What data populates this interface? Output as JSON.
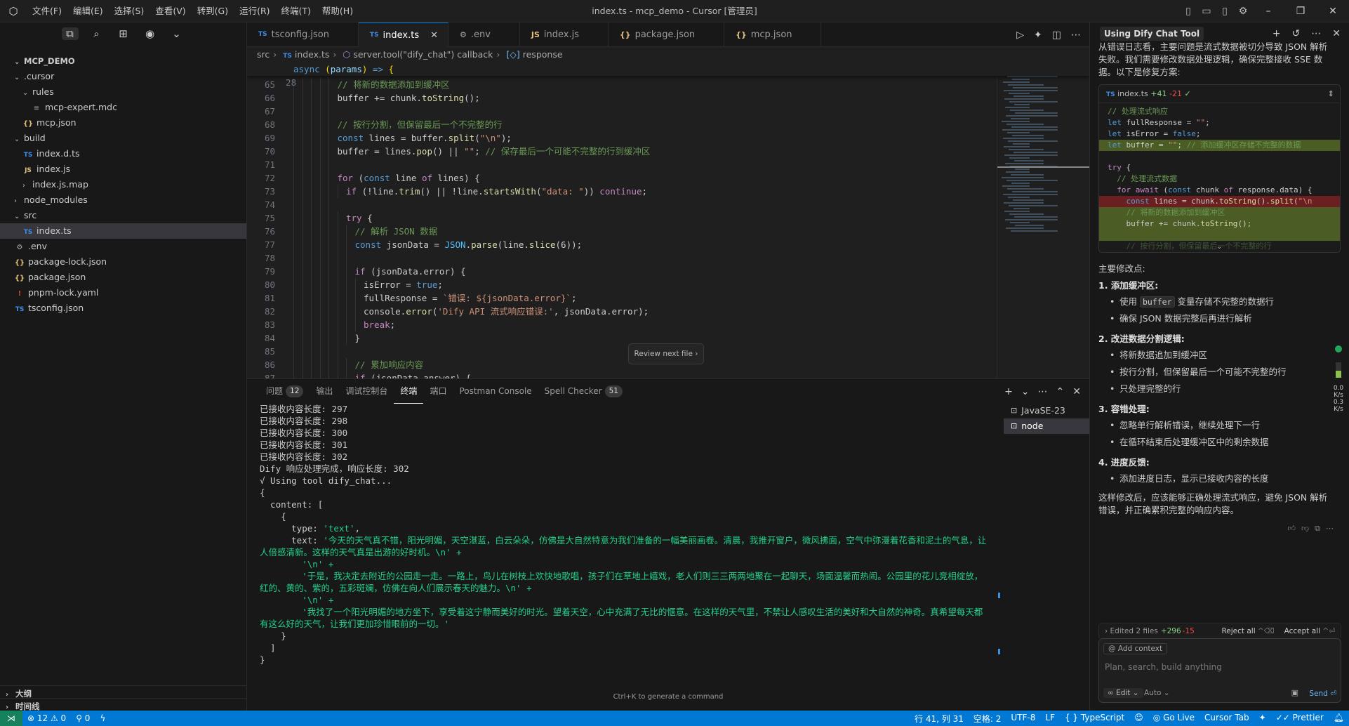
{
  "titlebar": {
    "menu": [
      "文件(F)",
      "编辑(E)",
      "选择(S)",
      "查看(V)",
      "转到(G)",
      "运行(R)",
      "终端(T)",
      "帮助(H)"
    ],
    "title": "index.ts - mcp_demo - Cursor [管理员]"
  },
  "explorer": {
    "root": "MCP_DEMO",
    "items": [
      {
        "label": ".cursor",
        "kind": "folder-open",
        "depth": 1
      },
      {
        "label": "rules",
        "kind": "folder-open",
        "depth": 2
      },
      {
        "label": "mcp-expert.mdc",
        "kind": "md",
        "depth": 3
      },
      {
        "label": "mcp.json",
        "kind": "json",
        "depth": 2
      },
      {
        "label": "build",
        "kind": "folder-open",
        "depth": 1
      },
      {
        "label": "index.d.ts",
        "kind": "ts",
        "depth": 2
      },
      {
        "label": "index.js",
        "kind": "js",
        "depth": 2
      },
      {
        "label": "index.js.map",
        "kind": "folder",
        "depth": 2
      },
      {
        "label": "node_modules",
        "kind": "folder",
        "depth": 1
      },
      {
        "label": "src",
        "kind": "folder-open",
        "depth": 1
      },
      {
        "label": "index.ts",
        "kind": "ts",
        "depth": 2,
        "selected": true
      },
      {
        "label": ".env",
        "kind": "gear",
        "depth": 1
      },
      {
        "label": "package-lock.json",
        "kind": "json",
        "depth": 1
      },
      {
        "label": "package.json",
        "kind": "json",
        "depth": 1
      },
      {
        "label": "pnpm-lock.yaml",
        "kind": "yaml",
        "depth": 1
      },
      {
        "label": "tsconfig.json",
        "kind": "ts",
        "depth": 1
      }
    ],
    "outline": "大纲",
    "timeline": "时间线"
  },
  "tabs": [
    {
      "label": "tsconfig.json",
      "icon": "TS",
      "active": false
    },
    {
      "label": "index.ts",
      "icon": "TS",
      "active": true
    },
    {
      "label": ".env",
      "icon": "gear",
      "active": false
    },
    {
      "label": "index.js",
      "icon": "JS",
      "active": false
    },
    {
      "label": "package.json",
      "icon": "{}",
      "active": false
    },
    {
      "label": "mcp.json",
      "icon": "{}",
      "active": false
    }
  ],
  "breadcrumb": [
    "src",
    "index.ts",
    "server.tool(\"dify_chat\") callback",
    "response"
  ],
  "editor": {
    "sticky": {
      "line": "28",
      "text": "async (params) => {"
    },
    "lines": [
      {
        "n": "65",
        "t": "// 将新的数据添加到缓冲区"
      },
      {
        "n": "66",
        "t": "buffer += chunk.toString();"
      },
      {
        "n": "67",
        "t": ""
      },
      {
        "n": "68",
        "t": "// 按行分割，但保留最后一个不完整的行"
      },
      {
        "n": "69",
        "t": "const lines = buffer.split(\"\\n\");"
      },
      {
        "n": "70",
        "t": "buffer = lines.pop() || \"\"; // 保存最后一个可能不完整的行到缓冲区"
      },
      {
        "n": "71",
        "t": ""
      },
      {
        "n": "72",
        "t": "for (const line of lines) {"
      },
      {
        "n": "73",
        "t": "if (!line.trim() || !line.startsWith(\"data: \")) continue;"
      },
      {
        "n": "74",
        "t": ""
      },
      {
        "n": "75",
        "t": "try {"
      },
      {
        "n": "76",
        "t": "// 解析 JSON 数据"
      },
      {
        "n": "77",
        "t": "const jsonData = JSON.parse(line.slice(6));"
      },
      {
        "n": "78",
        "t": ""
      },
      {
        "n": "79",
        "t": "if (jsonData.error) {"
      },
      {
        "n": "80",
        "t": "isError = true;"
      },
      {
        "n": "81",
        "t": "fullResponse = `错误: ${jsonData.error}`;"
      },
      {
        "n": "82",
        "t": "console.error('Dify API 流式响应错误:', jsonData.error);"
      },
      {
        "n": "83",
        "t": "break;"
      },
      {
        "n": "84",
        "t": "}"
      },
      {
        "n": "85",
        "t": ""
      },
      {
        "n": "86",
        "t": "// 累加响应内容"
      },
      {
        "n": "87",
        "t": "if (jsonData.answer) {"
      }
    ],
    "review_button": "Review next file"
  },
  "panel": {
    "tabs": [
      {
        "label": "问题",
        "badge": "12"
      },
      {
        "label": "输出"
      },
      {
        "label": "调试控制台"
      },
      {
        "label": "终端",
        "active": true
      },
      {
        "label": "端口"
      },
      {
        "label": "Postman Console"
      },
      {
        "label": "Spell Checker",
        "badge": "51"
      }
    ],
    "terminal_lines": [
      "已接收内容长度: 297",
      "已接收内容长度: 298",
      "已接收内容长度: 300",
      "已接收内容长度: 301",
      "已接收内容长度: 302",
      "Dify 响应处理完成，响应长度: 302",
      "√ Using tool dify_chat...",
      "{",
      "  content: [",
      "    {",
      "      type: 'text',"
    ],
    "terminal_text_label": "      text: ",
    "terminal_wrapped": [
      "'今天的天气真不错，阳光明媚，天空湛蓝，白云朵朵，仿佛是大自然特意为我们准备的一幅美丽画卷。清晨，我推开窗户，微风拂面，空气中弥漫着花香和泥土的气息，让人倍感清新。这样的天气真是出游的好时机。\\n' +",
      "'\\n' +",
      "'于是，我决定去附近的公园走一走。一路上，鸟儿在树枝上欢快地歌唱，孩子们在草地上嬉戏，老人们则三三两两地聚在一起聊天，场面温馨而热闹。公园里的花儿竞相绽放，红的、黄的、紫的，五彩斑斓，仿佛在向人们展示春天的魅力。\\n' +",
      "'\\n' +",
      "'我找了一个阳光明媚的地方坐下，享受着这宁静而美好的时光。望着天空，心中充满了无比的惬意。在这样的天气里，不禁让人感叹生活的美好和大自然的神奇。真希望每天都有这么好的天气，让我们更加珍惜眼前的一切。'"
    ],
    "terminal_tail": [
      "    }",
      "  ]",
      "}"
    ],
    "terminals": [
      {
        "label": "JavaSE-23",
        "selected": false
      },
      {
        "label": "node",
        "selected": true
      }
    ],
    "hint": "Ctrl+K to generate a command"
  },
  "chat": {
    "title": "Using Dify Chat Tool",
    "intro": "从错误日志看，主要问题是流式数据被切分导致 JSON 解析失败。我们需要修改数据处理逻辑，确保完整接收 SSE 数据。以下是修复方案:",
    "codeblock": {
      "file": "index.ts",
      "added": "+41",
      "removed": "-21",
      "lines": [
        {
          "t": "// 处理流式响应",
          "k": ""
        },
        {
          "t": "let fullResponse = \"\";",
          "k": ""
        },
        {
          "t": "let isError = false;",
          "k": ""
        },
        {
          "t": "let buffer = \"\"; // 添加缓冲区存储不完整的数据",
          "k": "added"
        },
        {
          "t": "",
          "k": ""
        },
        {
          "t": "try {",
          "k": ""
        },
        {
          "t": "  // 处理流式数据",
          "k": ""
        },
        {
          "t": "  for await (const chunk of response.data) {",
          "k": ""
        },
        {
          "t": "    const lines = chunk.toString().split(\"\\n",
          "k": "removed"
        },
        {
          "t": "    // 将新的数据添加到缓冲区",
          "k": "added"
        },
        {
          "t": "    buffer += chunk.toString();",
          "k": "added"
        },
        {
          "t": "",
          "k": "added"
        },
        {
          "t": "    // 按行分割，但保留最后一个不完整的行",
          "k": "faded"
        }
      ]
    },
    "summary_title": "主要修改点:",
    "sections": [
      {
        "title": "1. 添加缓冲区:",
        "items": [
          "使用 buffer 变量存储不完整的数据行",
          "确保 JSON 数据完整后再进行解析"
        ]
      },
      {
        "title": "2. 改进数据分割逻辑:",
        "items": [
          "将新数据追加到缓冲区",
          "按行分割，但保留最后一个可能不完整的行",
          "只处理完整的行"
        ]
      },
      {
        "title": "3. 容错处理:",
        "items": [
          "忽略单行解析错误，继续处理下一行",
          "在循环结束后处理缓冲区中的剩余数据"
        ]
      },
      {
        "title": "4. 进度反馈:",
        "items": [
          "添加进度日志，显示已接收内容的长度"
        ]
      }
    ],
    "inline_code": "buffer",
    "conclusion": "这样修改后，应该能够正确处理流式响应，避免 JSON 解析错误，并正确累积完整的响应内容。",
    "edited": {
      "label": "Edited 2 files",
      "added": "+296",
      "removed": "-15",
      "reject": "Reject all",
      "reject_key": "^⌫",
      "accept": "Accept all",
      "accept_key": "^⏎"
    },
    "add_context": "Add context",
    "placeholder": "Plan, search, build anything",
    "mode": "Edit",
    "model": "Auto",
    "send": "Send",
    "net_down": "0.0",
    "net_down_unit": "K/s",
    "net_up": "0.3",
    "net_up_unit": "K/s"
  },
  "statusbar": {
    "errors": "12",
    "warnings": "0",
    "ports": "0",
    "position": "行 41, 列 31",
    "spaces": "空格: 2",
    "encoding": "UTF-8",
    "eol": "LF",
    "language": "TypeScript",
    "golive": "Go Live",
    "cursortab": "Cursor Tab",
    "prettier": "Prettier"
  }
}
